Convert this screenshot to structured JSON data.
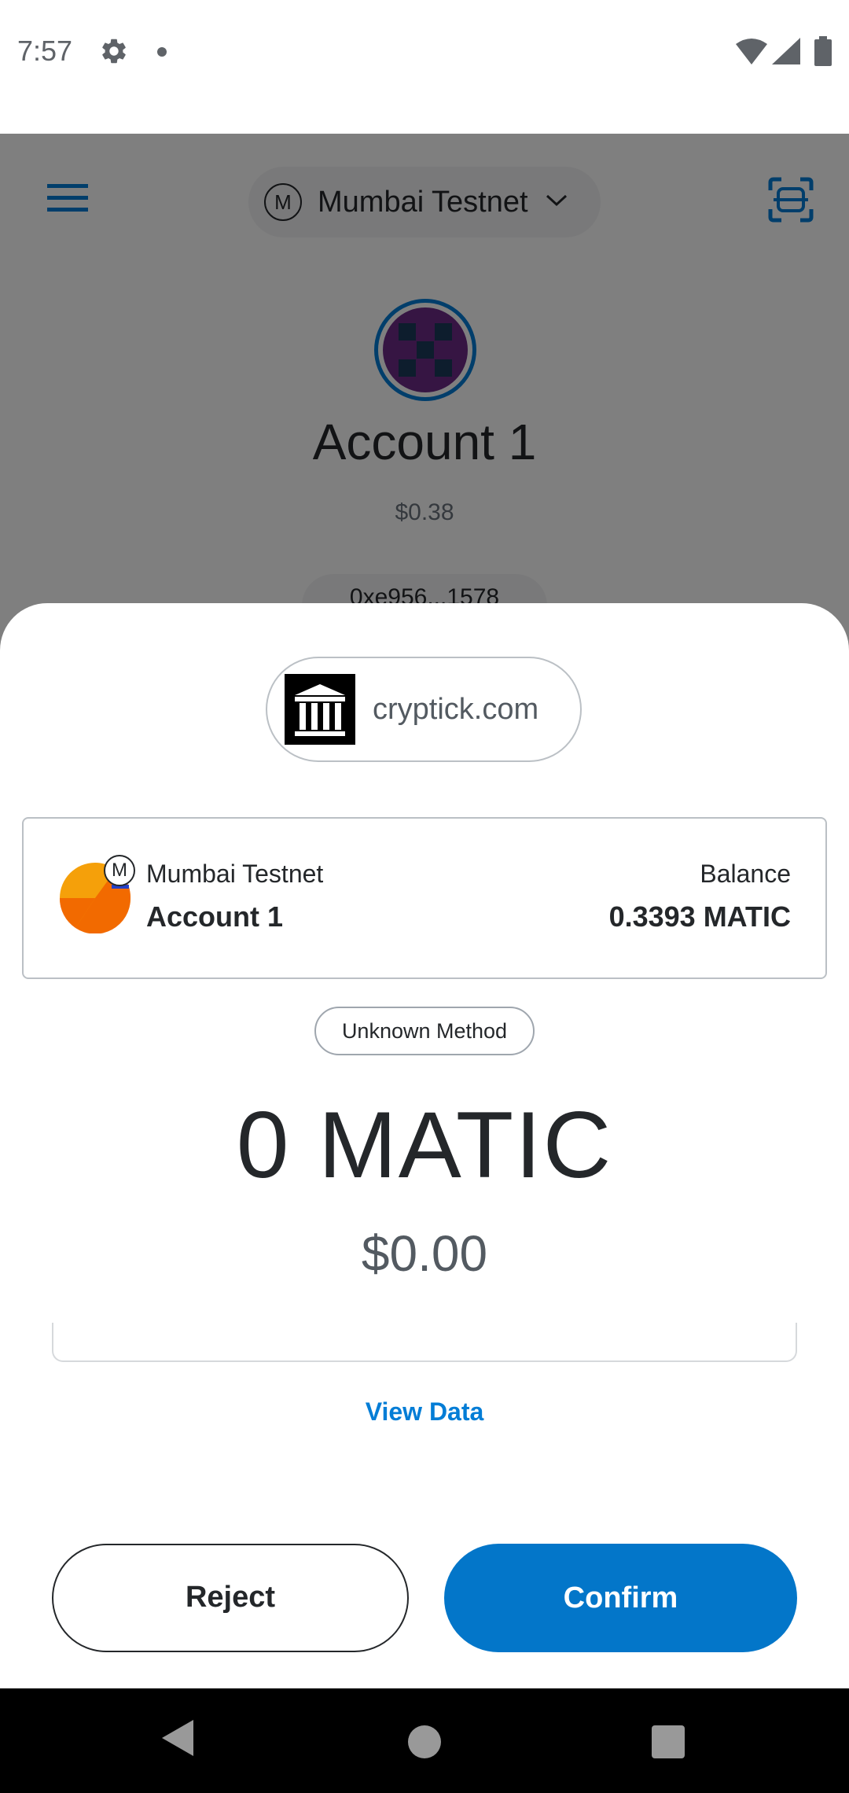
{
  "status_bar": {
    "time": "7:57"
  },
  "background_app": {
    "network": "Mumbai Testnet",
    "network_icon_letter": "M",
    "account_name": "Account 1",
    "account_fiat_balance": "$0.38",
    "address_partial": "0xe956...1578"
  },
  "sheet": {
    "origin": "cryptick.com",
    "account_card": {
      "network_name": "Mumbai Testnet",
      "network_badge_letter": "M",
      "account_name": "Account 1",
      "balance_label": "Balance",
      "balance_value": "0.3393 MATIC"
    },
    "method": "Unknown Method",
    "amount": "0 MATIC",
    "fiat": "$0.00",
    "view_data_label": "View Data",
    "reject_label": "Reject",
    "confirm_label": "Confirm"
  },
  "colors": {
    "accent": "#0376c9",
    "link": "#037dd6",
    "text": "#24272a"
  }
}
